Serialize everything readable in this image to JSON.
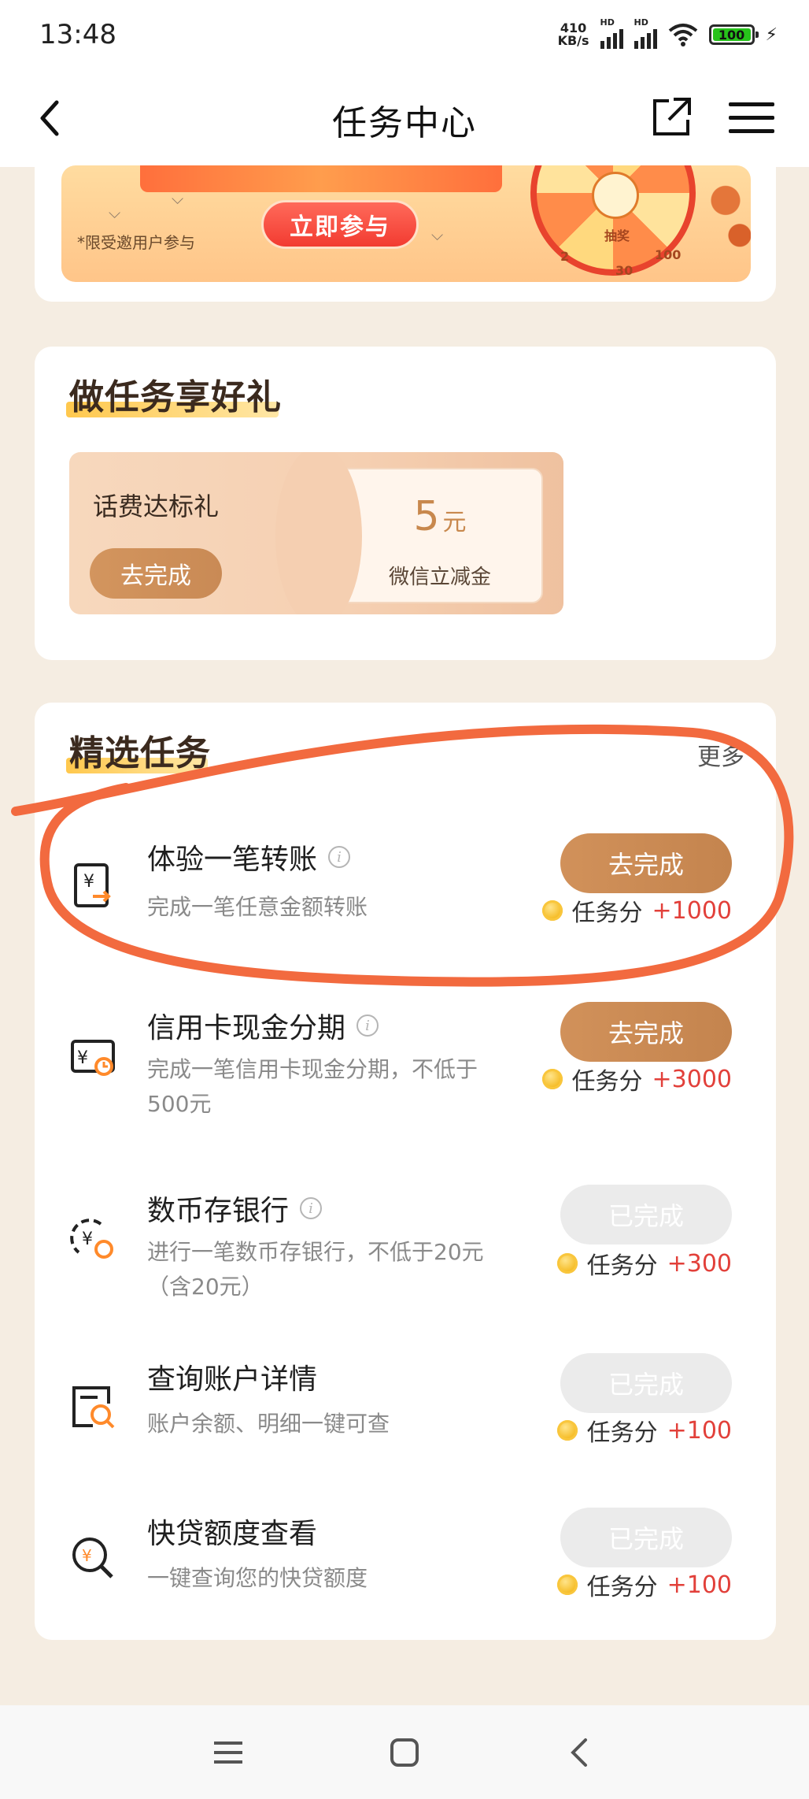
{
  "status_bar": {
    "time": "13:48",
    "net_speed_value": "410",
    "net_speed_unit": "KB/s",
    "signal_label": "HD",
    "battery": "100"
  },
  "nav": {
    "title": "任务中心",
    "back_icon": "chevron-left-icon",
    "share_icon": "share-icon",
    "menu_icon": "menu-icon"
  },
  "banner": {
    "note": "*限受邀用户参与",
    "join_label": "立即参与",
    "wheel_labels": [
      "抽奖",
      "2",
      "100",
      "30"
    ]
  },
  "gift_section": {
    "title": "做任务享好礼",
    "item": {
      "name": "话费达标礼",
      "action": "去完成",
      "amount": "5",
      "unit": "元",
      "desc": "微信立减金"
    }
  },
  "tasks_section": {
    "title": "精选任务",
    "more": "更多",
    "reward_label": "任务分",
    "tasks": [
      {
        "title": "体验一笔转账",
        "sub": "完成一笔任意金额转账",
        "action": "去完成",
        "status": "active",
        "points": "+1000",
        "icon": "transfer-icon"
      },
      {
        "title": "信用卡现金分期",
        "sub": "完成一笔信用卡现金分期，不低于500元",
        "action": "去完成",
        "status": "active",
        "points": "+3000",
        "icon": "card-installment-icon"
      },
      {
        "title": "数币存银行",
        "sub": "进行一笔数币存银行，不低于20元（含20元）",
        "action": "已完成",
        "status": "done",
        "points": "+300",
        "icon": "digital-currency-icon"
      },
      {
        "title": "查询账户详情",
        "sub": "账户余额、明细一键可查",
        "action": "已完成",
        "status": "done",
        "points": "+100",
        "icon": "account-search-icon"
      },
      {
        "title": "快贷额度查看",
        "sub": "一键查询您的快贷额度",
        "action": "已完成",
        "status": "done",
        "points": "+100",
        "icon": "loan-search-icon"
      }
    ]
  },
  "bottom_nav": {
    "icons": [
      "recent-apps-icon",
      "home-icon",
      "back-icon"
    ]
  },
  "colors": {
    "accent": "#c98a55",
    "points": "#e2403a",
    "highlight_circle": "#f26a3f",
    "page_bg": "#f5ede2"
  }
}
